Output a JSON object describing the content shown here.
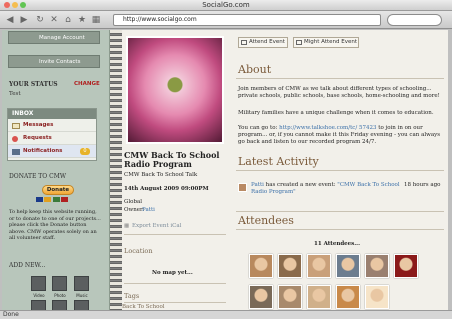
{
  "window": {
    "title": "SocialGo.com",
    "url": "http://www.socialgo.com",
    "status": "Done"
  },
  "sidebar": {
    "manage_account": "Manage Account",
    "invite_contacts": "Invite Contacts",
    "your_status_label": "YOUR STATUS",
    "change_label": "CHANGE",
    "status_text": "Test",
    "inbox": {
      "title": "INBOX",
      "items": [
        "Messages",
        "Requests",
        "Notifications"
      ],
      "notifications_count": "0"
    },
    "donate_label": "DONATE TO CMW",
    "donate_button": "Donate",
    "help_text": "To help keep this website running, or to donate to one of our projects... please click the Donate button above. CMW operates solely on an all volunteer staff.",
    "add_new_label": "ADD NEW...",
    "add_items": [
      "Video",
      "Photo",
      "Music"
    ]
  },
  "event": {
    "title": "CMW Back To School Radio Program",
    "subtitle": "CMW Back To School Talk",
    "datetime": "14th August 2009 09:00PM",
    "scope": "Global",
    "owner_label": "Owner:",
    "owner": "Patti",
    "export_label": "Export Event iCal",
    "location_label": "Location",
    "location_value": "No map yet...",
    "tags_label": "Tags",
    "tag": "Back To School"
  },
  "actions": {
    "attend": "Attend Event",
    "might_attend": "Might Attend Event"
  },
  "about": {
    "heading": "About",
    "p1": "Join members of CMW as we talk about different types of schooling... private schools, public schools, base schools, home-schooling and more!",
    "p2": "Military families have a unique challenge when it comes to education.",
    "p3_prefix": "You can go to: ",
    "p3_link": "http://www.talkshoe.com/tc/ 57423",
    "p3_suffix": " to join in on our program... or, if you cannot make it this Friday evening - you can always go back and listen to our recorded program 24/7."
  },
  "activity": {
    "heading": "Latest Activity",
    "actor": "Patti",
    "text_prefix": " has created a new event: ",
    "event_link": "\"CMW Back To School Radio Program\"",
    "time": "18 hours ago"
  },
  "attendees": {
    "heading": "Attendees",
    "count_label": "11 Attendees...",
    "tile_colors": [
      "#b8895e",
      "#8a6b4c",
      "#c9a07a",
      "#6c7d8f",
      "#9a8070",
      "#8b1a1a",
      "#7a6a58",
      "#a88a6c",
      "#d0b08a",
      "#c98a4a",
      "#f6e4c8"
    ]
  }
}
